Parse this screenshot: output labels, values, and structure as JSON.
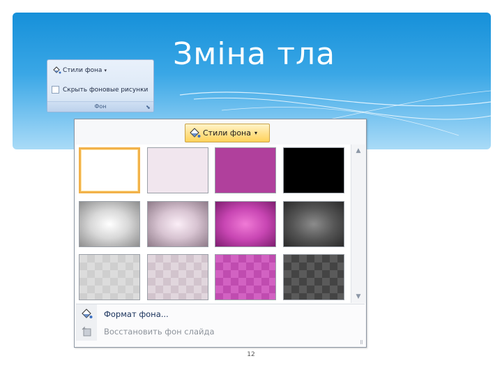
{
  "slide": {
    "title": "Зміна тла",
    "page_number": "12"
  },
  "ribbon_group": {
    "styles_label": "Стили фона",
    "hide_graphics_label": "Скрыть фоновые рисунки",
    "hide_graphics_checked": false,
    "group_label": "Фон"
  },
  "gallery": {
    "button_label": "Стили фона",
    "thumbnails": [
      {
        "name": "thumb-white",
        "fill": "#ffffff",
        "selected": true
      },
      {
        "name": "thumb-light-pink",
        "fill": "#f1e6ee",
        "selected": false
      },
      {
        "name": "thumb-magenta",
        "fill": "#b0409c",
        "selected": false
      },
      {
        "name": "thumb-black",
        "fill": "#000000",
        "selected": false
      },
      {
        "name": "thumb-gray-radial",
        "fill": "radial-gradient(ellipse at center,#ffffff 0%,#d8d8d8 45%,#8d8d8d 100%)",
        "selected": false
      },
      {
        "name": "thumb-pink-radial",
        "fill": "radial-gradient(ellipse at center,#fbeef7 0%,#d8c4d2 45%,#8e7a88 100%)",
        "selected": false
      },
      {
        "name": "thumb-magenta-radial",
        "fill": "radial-gradient(ellipse at center,#f07ad6 0%,#c846b3 50%,#7e1e6f 100%)",
        "selected": false
      },
      {
        "name": "thumb-dark-gray-radial",
        "fill": "radial-gradient(ellipse at center,#8c8c8c 0%,#555555 50%,#2a2a2a 100%)",
        "selected": false
      },
      {
        "name": "thumb-gray-diamond",
        "fill": "#dcdcdc",
        "pattern": "#cfcfcf",
        "selected": false
      },
      {
        "name": "thumb-pink-diamond",
        "fill": "#e1d6dd",
        "pattern": "#d2c4cd",
        "selected": false
      },
      {
        "name": "thumb-magenta-diamond",
        "fill": "#d262c2",
        "pattern": "#c04cb0",
        "selected": false
      },
      {
        "name": "thumb-dark-diamond",
        "fill": "#5a5a5a",
        "pattern": "#444444",
        "selected": false
      }
    ],
    "menu": [
      {
        "label": "Формат фона...",
        "enabled": true,
        "icon": "paint-bucket-icon"
      },
      {
        "label": "Восстановить фон слайда",
        "enabled": false,
        "icon": "reset-background-icon"
      }
    ]
  },
  "colors": {
    "header_blue": "#1690d9",
    "selection_orange": "#f2b24a"
  }
}
